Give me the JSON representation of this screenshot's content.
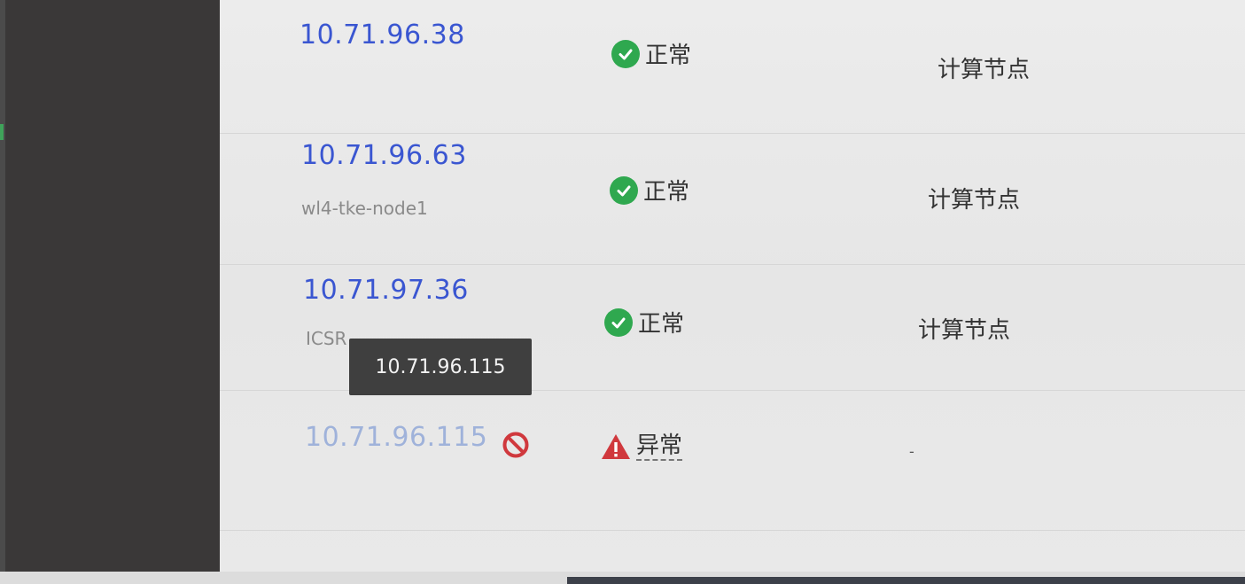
{
  "nodes": [
    {
      "ip": "10.71.96.38",
      "hostname": "",
      "status": "正常",
      "role": "计算节点"
    },
    {
      "ip": "10.71.96.63",
      "hostname": "wl4-tke-node1",
      "status": "正常",
      "role": "计算节点"
    },
    {
      "ip": "10.71.97.36",
      "hostname": "ICSR",
      "status": "正常",
      "role": "计算节点"
    },
    {
      "ip": "10.71.96.115",
      "hostname": "",
      "status": "异常",
      "role": "-"
    }
  ],
  "tooltip": {
    "text": "10.71.96.115"
  },
  "colors": {
    "ip_link": "#3a56d1",
    "ok": "#2fa84f",
    "error": "#d0383d",
    "tooltip_bg": "#3f3f3f"
  },
  "icons": {
    "ok": "check-circle-icon",
    "warning": "warning-triangle-icon",
    "disabled": "forbidden-icon"
  }
}
